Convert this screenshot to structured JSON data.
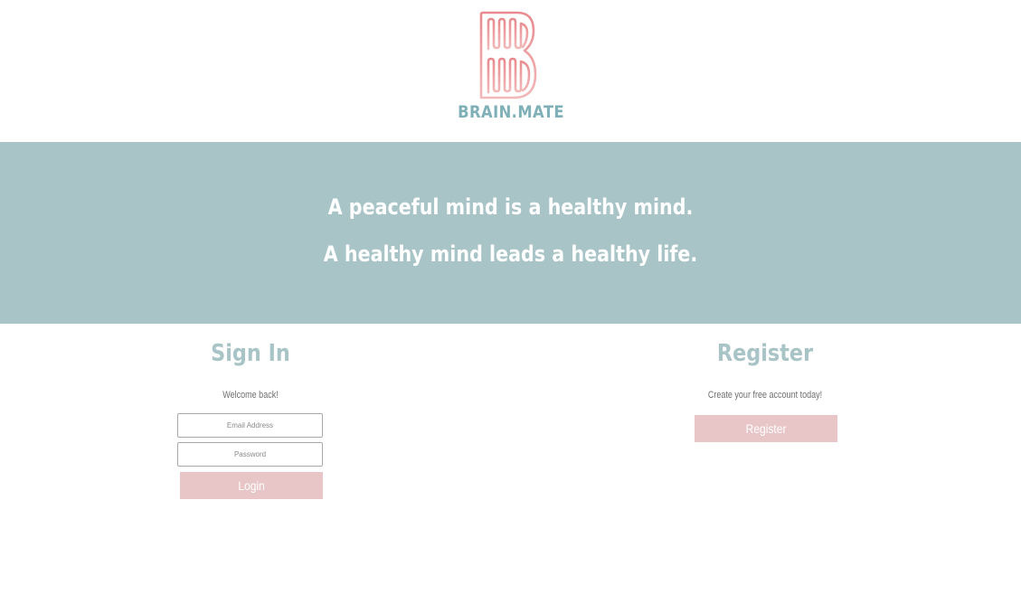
{
  "brand": {
    "name": "BRAIN.MATE",
    "colors": {
      "accent_teal": "#a8c4c6",
      "logo_text": "#7fb0b8",
      "accent_pink": "#e8c6c8",
      "logo_pink": "#e09a9c"
    }
  },
  "hero": {
    "line1": "A peaceful mind is a healthy mind.",
    "line2": "A healthy mind leads a healthy life."
  },
  "signin": {
    "title": "Sign In",
    "subtitle": "Welcome back!",
    "email_placeholder": "Email Address",
    "password_placeholder": "Password",
    "button_label": "Login"
  },
  "register": {
    "title": "Register",
    "subtitle": "Create your free account today!",
    "button_label": "Register"
  },
  "icons": {
    "logo": "brain-b-logo-icon"
  }
}
